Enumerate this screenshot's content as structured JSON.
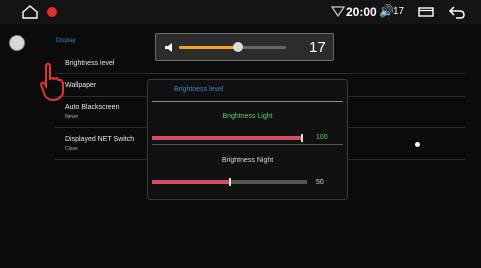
{
  "status_bar": {
    "icons": [
      "home-icon",
      "stop-icon",
      "wifi-icon",
      "volume-icon",
      "window-icon",
      "back-icon"
    ],
    "time": "20:00",
    "volume_symbol": "🔊",
    "volume_level": "17"
  },
  "settings": {
    "section_title": "Display",
    "rows": [
      {
        "label": "Brightness level"
      },
      {
        "label": "Wallpaper"
      },
      {
        "label": "Auto Blackscreen",
        "sub": "Never"
      },
      {
        "label": "Displayed NET Switch",
        "sub": "Close"
      }
    ]
  },
  "volume_popup": {
    "value": "17",
    "fraction": 0.55,
    "colors": {
      "fill": "#f2a521",
      "track": "#666666"
    }
  },
  "brightness_dialog": {
    "title": "Brightness level",
    "light": {
      "label": "Brightness Light",
      "value": "100",
      "fraction": 1.0
    },
    "night": {
      "label": "Brightness Night",
      "value": "50",
      "fraction": 0.5
    },
    "colors": {
      "accent": "#d54a66",
      "light_text": "#5bd35b",
      "title": "#3b86d6"
    }
  }
}
